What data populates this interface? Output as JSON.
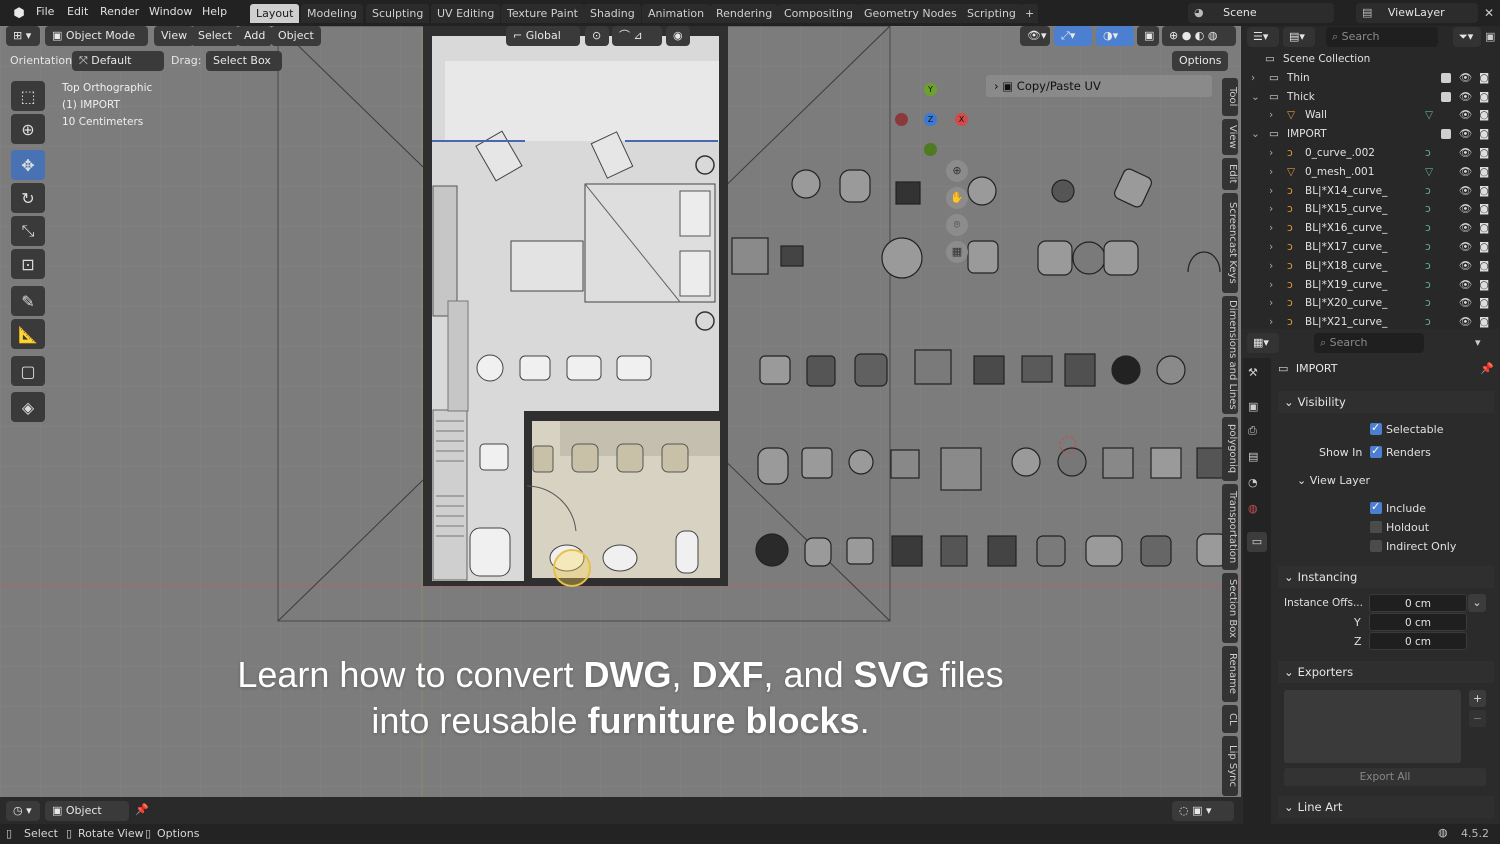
{
  "menu": {
    "file": "File",
    "edit": "Edit",
    "render": "Render",
    "window": "Window",
    "help": "Help"
  },
  "workspace_tabs": [
    "Layout",
    "Modeling",
    "Sculpting",
    "UV Editing",
    "Texture Paint",
    "Shading",
    "Animation",
    "Rendering",
    "Compositing",
    "Geometry Nodes",
    "Scripting"
  ],
  "scene": {
    "label": "Scene",
    "view_layer": "ViewLayer"
  },
  "viewport_header": {
    "mode": "Object Mode",
    "view": "View",
    "select": "Select",
    "add": "Add",
    "object": "Object",
    "transform": "Global",
    "options": "Options"
  },
  "toolbar_row": {
    "orientation_label": "Orientation:",
    "orientation_value": "Default",
    "drag_label": "Drag:",
    "drag_value": "Select Box"
  },
  "overlay_text": {
    "view": "Top Orthographic",
    "collection": "(1) IMPORT",
    "scale": "10 Centimeters"
  },
  "gizmo": {
    "y": "Y",
    "x": "X",
    "z": "Z"
  },
  "copy_paste_panel": "Copy/Paste UV",
  "n_panel_tabs": [
    "Tool",
    "View",
    "Edit",
    "Screencast Keys",
    "Dimensions and Lines",
    "polygoniq",
    "Transportation",
    "Section Box",
    "Rename",
    "CL",
    "Lip Sync"
  ],
  "caption": {
    "line1": [
      {
        "t": "Learn how to convert ",
        "b": false
      },
      {
        "t": "DWG",
        "b": true
      },
      {
        "t": ", ",
        "b": false
      },
      {
        "t": "DXF",
        "b": true
      },
      {
        "t": ", and ",
        "b": false
      },
      {
        "t": "SVG",
        "b": true
      },
      {
        "t": " files",
        "b": false
      }
    ],
    "line2": [
      {
        "t": "into reusable ",
        "b": false
      },
      {
        "t": "furniture blocks",
        "b": true
      },
      {
        "t": ".",
        "b": false
      }
    ]
  },
  "outliner": {
    "search_placeholder": "Search",
    "rows": [
      {
        "label": "Scene Collection",
        "level": 0,
        "type": "scene"
      },
      {
        "label": "Thin",
        "level": 1,
        "type": "collection"
      },
      {
        "label": "Thick",
        "level": 1,
        "type": "collection"
      },
      {
        "label": "Wall",
        "level": 2,
        "type": "mesh"
      },
      {
        "label": "IMPORT",
        "level": 1,
        "type": "collection"
      },
      {
        "label": "0_curve_.002",
        "level": 2,
        "type": "curve"
      },
      {
        "label": "0_mesh_.001",
        "level": 2,
        "type": "mesh"
      },
      {
        "label": "BL|*X14_curve_",
        "level": 2,
        "type": "curve"
      },
      {
        "label": "BL|*X15_curve_",
        "level": 2,
        "type": "curve"
      },
      {
        "label": "BL|*X16_curve_",
        "level": 2,
        "type": "curve"
      },
      {
        "label": "BL|*X17_curve_",
        "level": 2,
        "type": "curve"
      },
      {
        "label": "BL|*X18_curve_",
        "level": 2,
        "type": "curve"
      },
      {
        "label": "BL|*X19_curve_",
        "level": 2,
        "type": "curve"
      },
      {
        "label": "BL|*X20_curve_",
        "level": 2,
        "type": "curve"
      },
      {
        "label": "BL|*X21_curve_",
        "level": 2,
        "type": "curve"
      }
    ]
  },
  "properties": {
    "search_placeholder": "Search",
    "name": "IMPORT",
    "visibility": "Visibility",
    "selectable": "Selectable",
    "show_in": "Show In",
    "renders": "Renders",
    "view_layer": "View Layer",
    "include": "Include",
    "holdout": "Holdout",
    "indirect_only": "Indirect Only",
    "instancing": "Instancing",
    "instance_offset": "Instance Offs...",
    "offset_x": "0 cm",
    "y_label": "Y",
    "offset_y": "0 cm",
    "z_label": "Z",
    "offset_z": "0 cm",
    "exporters": "Exporters",
    "export_all": "Export All",
    "line_art": "Line Art"
  },
  "bottom_header": {
    "mode": "Object"
  },
  "statusbar": {
    "select": "Select",
    "rotate": "Rotate View",
    "options": "Options",
    "version": "4.5.2"
  },
  "colors": {
    "accent": "#4d7fd1",
    "viewport_bg": "#7c7c7c",
    "active_tool": "#4872b4",
    "collection_icon": "#d1d1d1",
    "curve_icon": "#e09a3c",
    "mesh_icon": "#e09a3c",
    "data_icon": "#5fb3a0"
  }
}
